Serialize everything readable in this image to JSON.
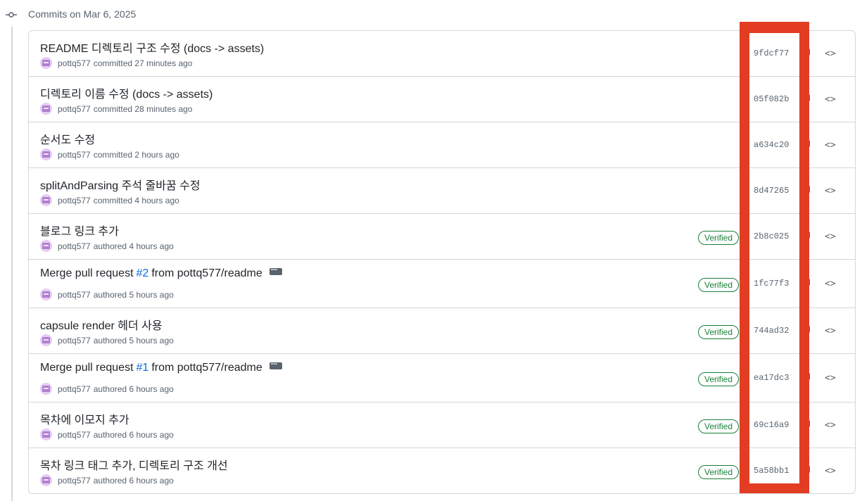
{
  "group": {
    "title": "Commits on Mar 6, 2025"
  },
  "highlight_color": "#e23d23",
  "commits": [
    {
      "title": "README 디렉토리 구조 수정 (docs -> assets)",
      "author": "pottq577",
      "action": "committed",
      "time": "27 minutes ago",
      "verified": "",
      "sha": "9fdcf77"
    },
    {
      "title": "디렉토리 이름 수정 (docs -> assets)",
      "author": "pottq577",
      "action": "committed",
      "time": "28 minutes ago",
      "verified": "",
      "sha": "05f082b"
    },
    {
      "title": "순서도 수정",
      "author": "pottq577",
      "action": "committed",
      "time": "2 hours ago",
      "verified": "",
      "sha": "a634c20"
    },
    {
      "title": "splitAndParsing 주석 줄바꿈 수정",
      "author": "pottq577",
      "action": "committed",
      "time": "4 hours ago",
      "verified": "",
      "sha": "8d47265"
    },
    {
      "title": "블로그 링크 추가",
      "author": "pottq577",
      "action": "authored",
      "time": "4 hours ago",
      "verified": "Verified",
      "sha": "2b8c025"
    },
    {
      "title_pre": "Merge pull request",
      "pr": "#2",
      "title_post": "from pottq577/readme",
      "author": "pottq577",
      "action": "authored",
      "time": "5 hours ago",
      "verified": "Verified",
      "sha": "1fc77f3"
    },
    {
      "title": "capsule render 헤더 사용",
      "author": "pottq577",
      "action": "authored",
      "time": "5 hours ago",
      "verified": "Verified",
      "sha": "744ad32"
    },
    {
      "title_pre": "Merge pull request",
      "pr": "#1",
      "title_post": "from pottq577/readme",
      "author": "pottq577",
      "action": "authored",
      "time": "6 hours ago",
      "verified": "Verified",
      "sha": "ea17dc3"
    },
    {
      "title": "목차에 이모지 추가",
      "author": "pottq577",
      "action": "authored",
      "time": "6 hours ago",
      "verified": "Verified",
      "sha": "69c16a9"
    },
    {
      "title": "목차 링크 태그 추가, 디렉토리 구조 개선",
      "author": "pottq577",
      "action": "authored",
      "time": "6 hours ago",
      "verified": "Verified",
      "sha": "5a58bb1"
    }
  ]
}
